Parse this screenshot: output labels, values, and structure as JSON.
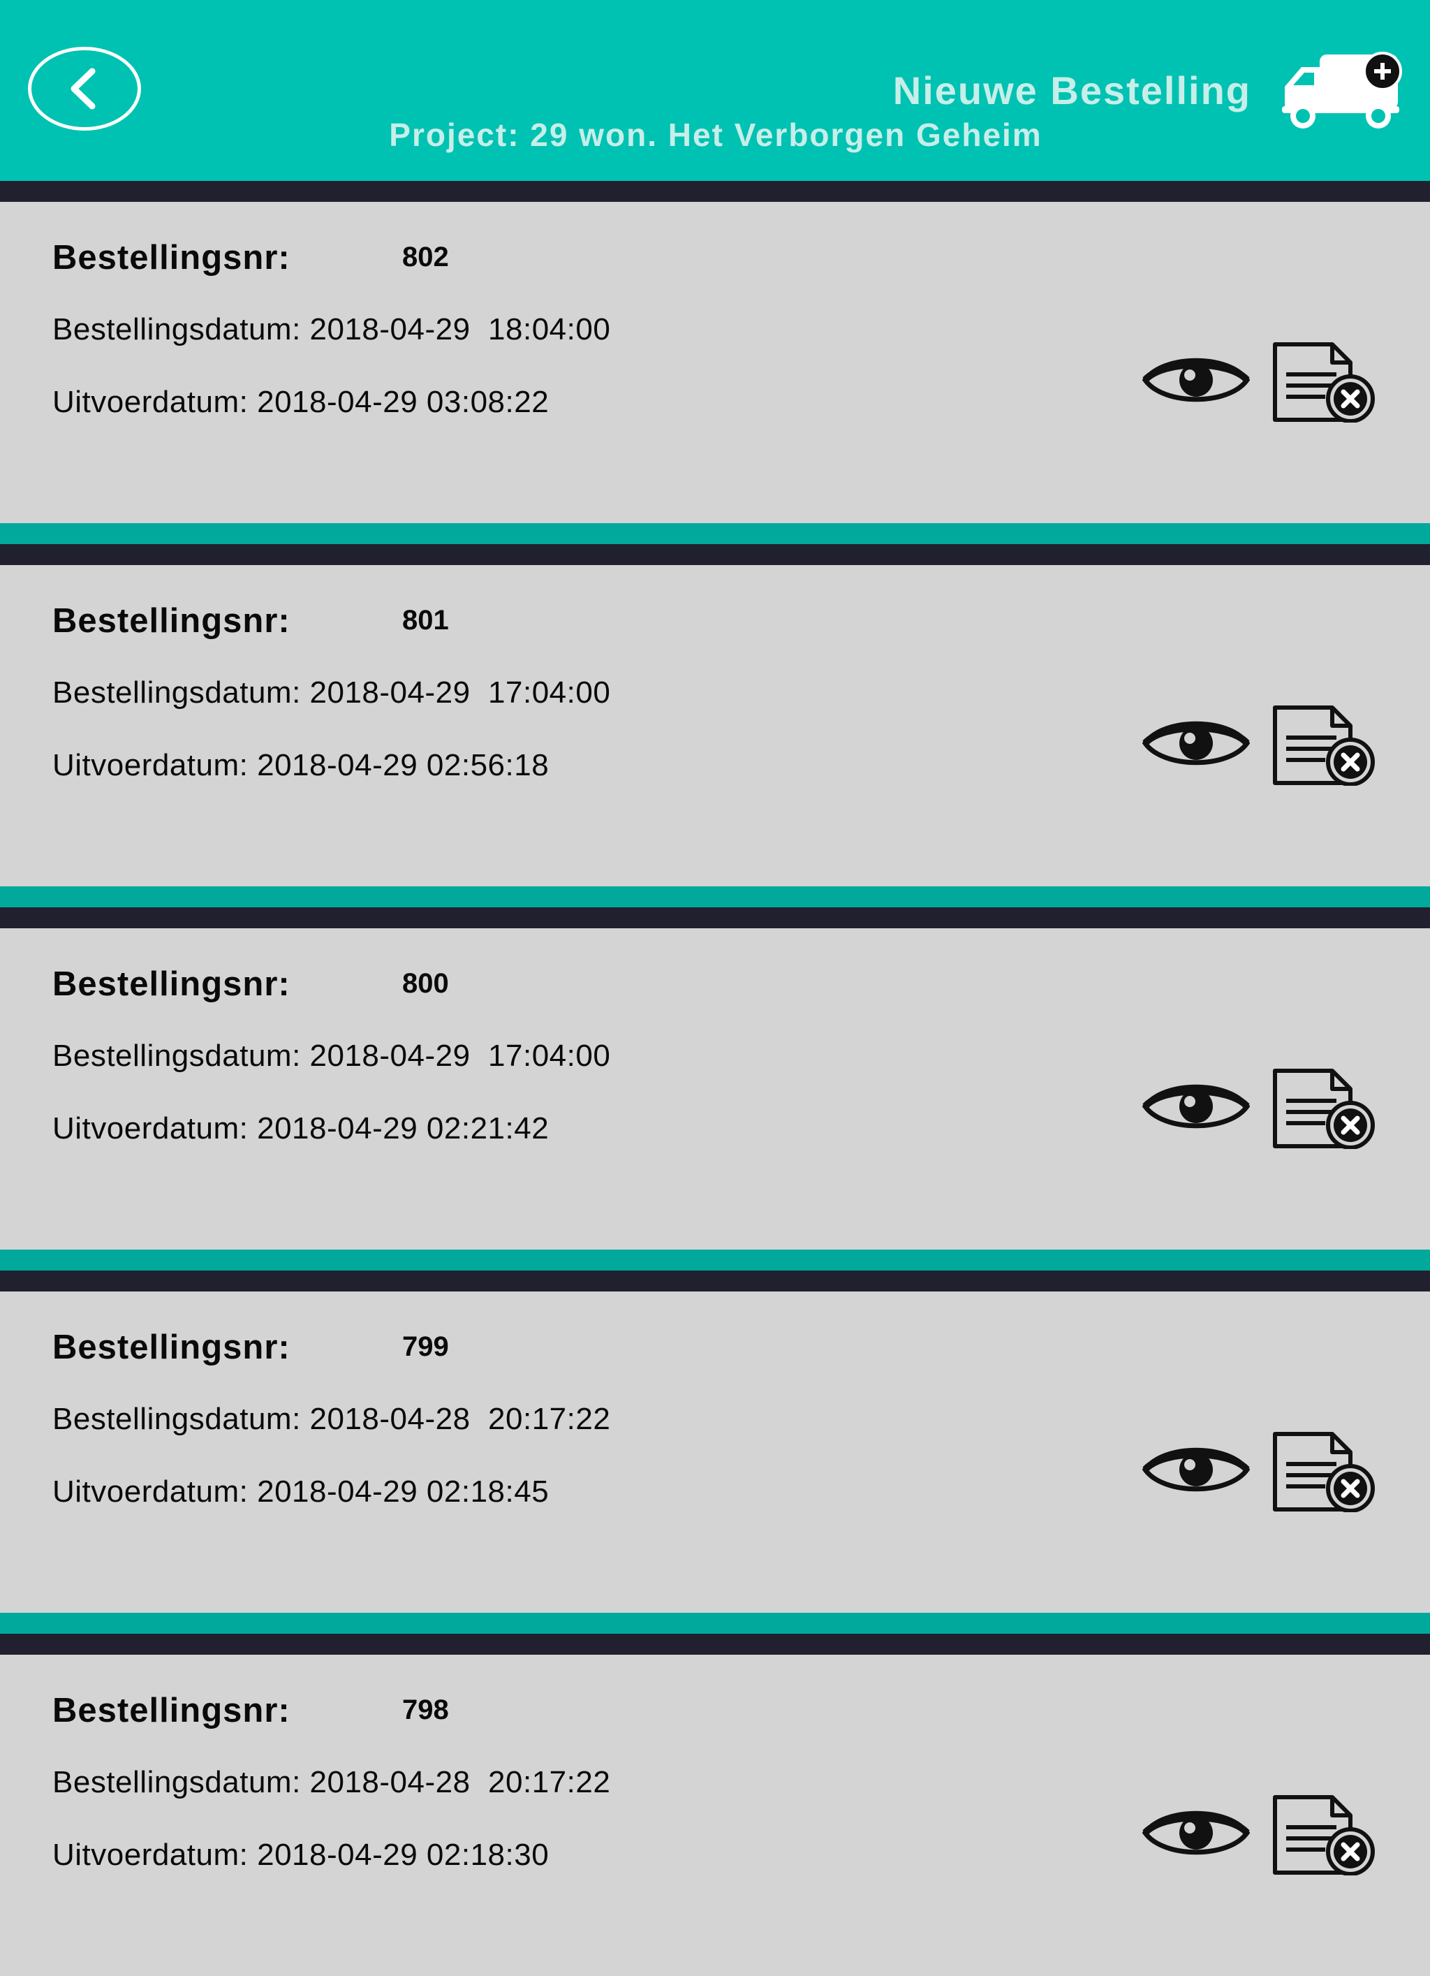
{
  "theme": {
    "accent": "#00c2b2",
    "separator_teal": "#00a99c",
    "separator_dark": "#20202f",
    "card_bg": "#d4d4d4",
    "header_text": "#c7eee9"
  },
  "header": {
    "title": "Nieuwe Bestelling",
    "subtitle": "Project: 29 won. Het Verborgen Geheim",
    "back_icon": "chevron-left-icon",
    "new_order_icon": "delivery-truck-plus-icon"
  },
  "orders": [
    {
      "number_label": "Bestellingsnr:",
      "number": "802",
      "order_date": "Bestellingsdatum: 2018-04-29  18:04:00",
      "execution_date": "Uitvoerdatum: 2018-04-29 03:08:22"
    },
    {
      "number_label": "Bestellingsnr:",
      "number": "801",
      "order_date": "Bestellingsdatum: 2018-04-29  17:04:00",
      "execution_date": "Uitvoerdatum: 2018-04-29 02:56:18"
    },
    {
      "number_label": "Bestellingsnr:",
      "number": "800",
      "order_date": "Bestellingsdatum: 2018-04-29  17:04:00",
      "execution_date": "Uitvoerdatum: 2018-04-29 02:21:42"
    },
    {
      "number_label": "Bestellingsnr:",
      "number": "799",
      "order_date": "Bestellingsdatum: 2018-04-28  20:17:22",
      "execution_date": "Uitvoerdatum: 2018-04-29 02:18:45"
    },
    {
      "number_label": "Bestellingsnr:",
      "number": "798",
      "order_date": "Bestellingsdatum: 2018-04-28  20:17:22",
      "execution_date": "Uitvoerdatum: 2018-04-29 02:18:30"
    }
  ],
  "icons": {
    "view": "eye-icon",
    "cancel": "document-cancel-icon"
  }
}
